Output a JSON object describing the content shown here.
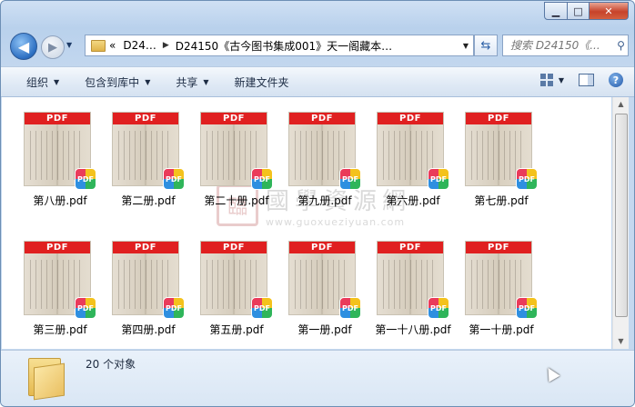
{
  "window": {
    "caption_buttons": {
      "minimize": "▁",
      "maximize": "□",
      "close": "✕"
    }
  },
  "nav": {
    "back_glyph": "◀",
    "forward_glyph": "▶",
    "address": {
      "chevron": "«",
      "crumb1": "D24…",
      "crumb2": "D24150《古今图书集成001》天一阁藏本…"
    },
    "search": {
      "placeholder": "搜索 D24150《..."
    }
  },
  "toolbar": {
    "organize": "组织",
    "include_library": "包含到库中",
    "share": "共享",
    "new_folder": "新建文件夹",
    "help": "?"
  },
  "files": [
    {
      "name": "第八册.pdf"
    },
    {
      "name": "第二册.pdf"
    },
    {
      "name": "第二十册.pdf"
    },
    {
      "name": "第九册.pdf"
    },
    {
      "name": "第六册.pdf"
    },
    {
      "name": "第七册.pdf"
    },
    {
      "name": "第三册.pdf"
    },
    {
      "name": "第四册.pdf"
    },
    {
      "name": "第五册.pdf"
    },
    {
      "name": "第一册.pdf"
    },
    {
      "name": "第一十八册.pdf"
    },
    {
      "name": "第一十册.pdf"
    }
  ],
  "thumb": {
    "pdf_label": "PDF",
    "badge": "PDF"
  },
  "watermark": {
    "logo": "臨",
    "title": "國學資源網",
    "url": "www.guoxueziyuan.com"
  },
  "status": {
    "count": "20 个对象"
  }
}
